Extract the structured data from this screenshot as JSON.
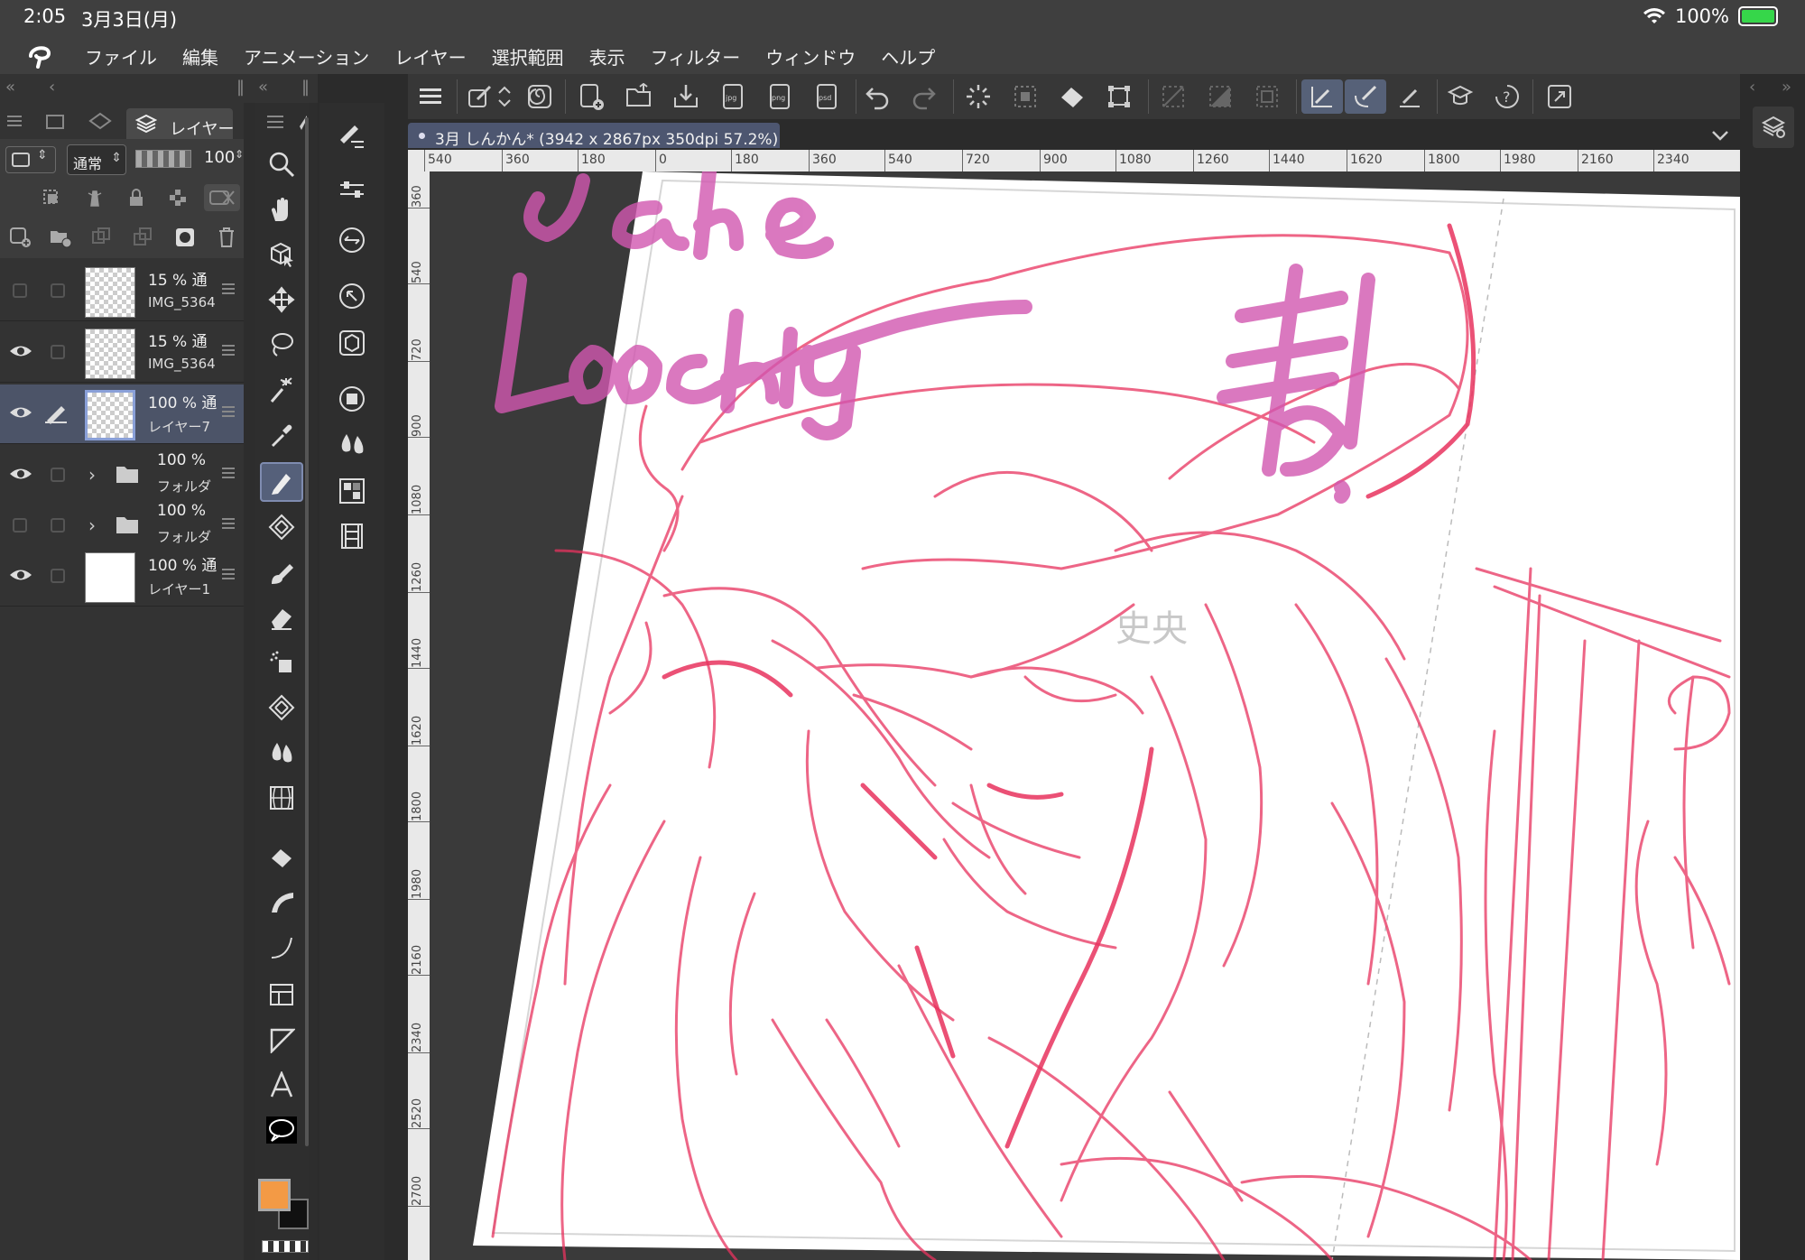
{
  "status_bar": {
    "time": "2:05",
    "date": "3月3日(月)",
    "battery_percent": "100%",
    "battery_level": 1.0,
    "wifi_icon": "wifi-icon"
  },
  "menu": {
    "items": [
      "ファイル",
      "編集",
      "アニメーション",
      "レイヤー",
      "選択範囲",
      "表示",
      "フィルター",
      "ウィンドウ",
      "ヘルプ"
    ]
  },
  "layer_panel": {
    "tab_label": "レイヤー",
    "blend_mode": "通常",
    "opacity": "100",
    "layers": [
      {
        "opacity": "15 % 通",
        "name": "IMG_5364",
        "visible": false,
        "kind": "image"
      },
      {
        "opacity": "15 % 通",
        "name": "IMG_5364",
        "visible": true,
        "kind": "image"
      },
      {
        "opacity": "100 % 通",
        "name": "レイヤー7",
        "visible": true,
        "kind": "raster",
        "selected": true
      },
      {
        "opacity": "100 %",
        "name": "フォルダ",
        "visible": true,
        "kind": "folder"
      },
      {
        "opacity": "100 %",
        "name": "フォルダ",
        "visible": false,
        "kind": "folder"
      },
      {
        "opacity": "100 % 通",
        "name": "レイヤー1",
        "visible": true,
        "kind": "paper"
      }
    ]
  },
  "document": {
    "tab_title": "3月 しんかん* (3942 x 2867px 350dpi 57.2%)"
  },
  "ruler": {
    "top_labels": [
      "540",
      "360",
      "180",
      "0",
      "180",
      "360",
      "540",
      "720",
      "900",
      "1080",
      "1260",
      "1440",
      "1620",
      "1800",
      "1980",
      "2160",
      "2340"
    ],
    "left_labels": [
      "360",
      "540",
      "720",
      "900",
      "1080",
      "1260",
      "1440",
      "1620",
      "1800",
      "1980",
      "2160",
      "2340",
      "2520",
      "2700"
    ]
  },
  "colors": {
    "main_color": "#f39a45",
    "sub_color": "#111111",
    "sketch_line": "#e8325e",
    "text_overlay": "#d257b0"
  },
  "canvas_text": {
    "watermark": "史央"
  }
}
